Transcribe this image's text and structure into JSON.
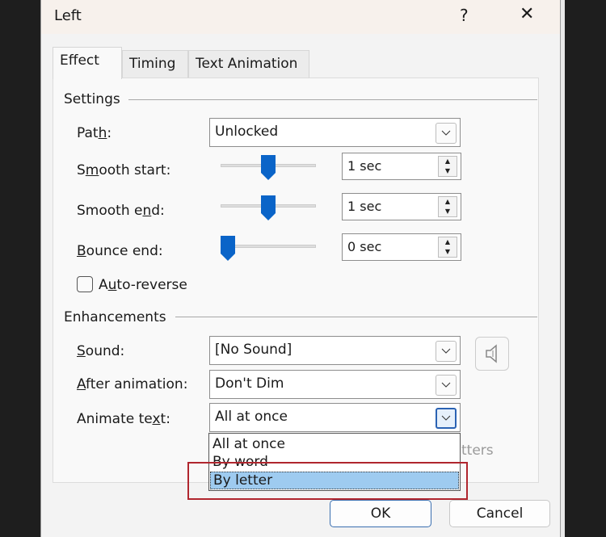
{
  "dialog": {
    "title": "Left",
    "help_label": "?",
    "close_label": "✕"
  },
  "tabs": [
    {
      "label": "Effect",
      "active": true
    },
    {
      "label": "Timing"
    },
    {
      "label": "Text Animation"
    }
  ],
  "settings": {
    "heading": "Settings",
    "path": {
      "label_pre": "Pat",
      "label_u": "h",
      "label_post": ":",
      "value": "Unlocked"
    },
    "smooth_start": {
      "label_pre": "S",
      "label_u": "m",
      "label_post": "ooth start:",
      "value": "1 sec",
      "slider_fraction": 0.5
    },
    "smooth_end": {
      "label_pre": "Smooth e",
      "label_u": "n",
      "label_post": "d:",
      "value": "1 sec",
      "slider_fraction": 0.5
    },
    "bounce_end": {
      "label_pre": "",
      "label_u": "B",
      "label_post": "ounce end:",
      "value": "0 sec",
      "slider_fraction": 0.0
    },
    "auto_reverse": {
      "label_pre": "A",
      "label_u": "u",
      "label_post": "to-reverse",
      "checked": false
    }
  },
  "enhancements": {
    "heading": "Enhancements",
    "sound": {
      "label_pre": "",
      "label_u": "S",
      "label_post": "ound:",
      "value": "[No Sound]"
    },
    "after": {
      "label_pre": "",
      "label_u": "A",
      "label_post": "fter animation:",
      "value": "Don't Dim"
    },
    "animate_text": {
      "label_pre": "Animate te",
      "label_u": "x",
      "label_post": "t:",
      "value": "All at once"
    },
    "hidden_label_fragment": "tters",
    "dropdown_options": [
      "All at once",
      "By word",
      "By letter"
    ],
    "highlighted_option": "By letter"
  },
  "buttons": {
    "ok": "OK",
    "cancel": "Cancel"
  },
  "colors": {
    "accent": "#0a64c8",
    "highlight": "#9ecbf0",
    "annotation": "#b0262e"
  }
}
